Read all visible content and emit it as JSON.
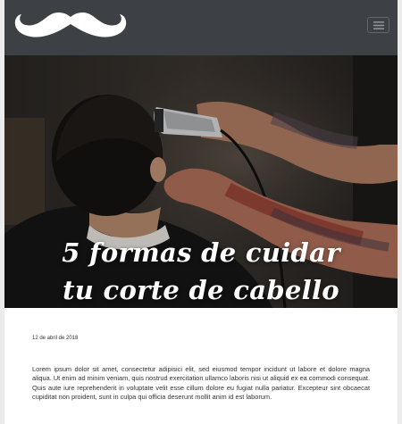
{
  "header": {
    "logo_icon": "mustache-icon",
    "menu_icon": "hamburger-menu-icon",
    "colors": {
      "bar": "#3d4145",
      "logo": "#ffffff"
    }
  },
  "hero": {
    "title_line1": "5 formas de cuidar",
    "title_line2": "tu corte de cabello"
  },
  "article": {
    "date": "12 de abril de 2018",
    "body": "Lorem ipsum dolor sit amet, consectetur adipisici elit, sed eiusmod tempor incidunt ut labore et dolore magna aliqua. Ut enim ad minim veniam, quis nostrud exercitation ullamco laboris nisi ut aliquid ex ea commodi consequat. Quis aute iure reprehenderit in voluptate velit esse cillum dolore eu fugiat nulla pariatur. Excepteur sint obcaecat cupiditat non proident, sunt in culpa qui officia deserunt mollit anim id est laborum."
  }
}
